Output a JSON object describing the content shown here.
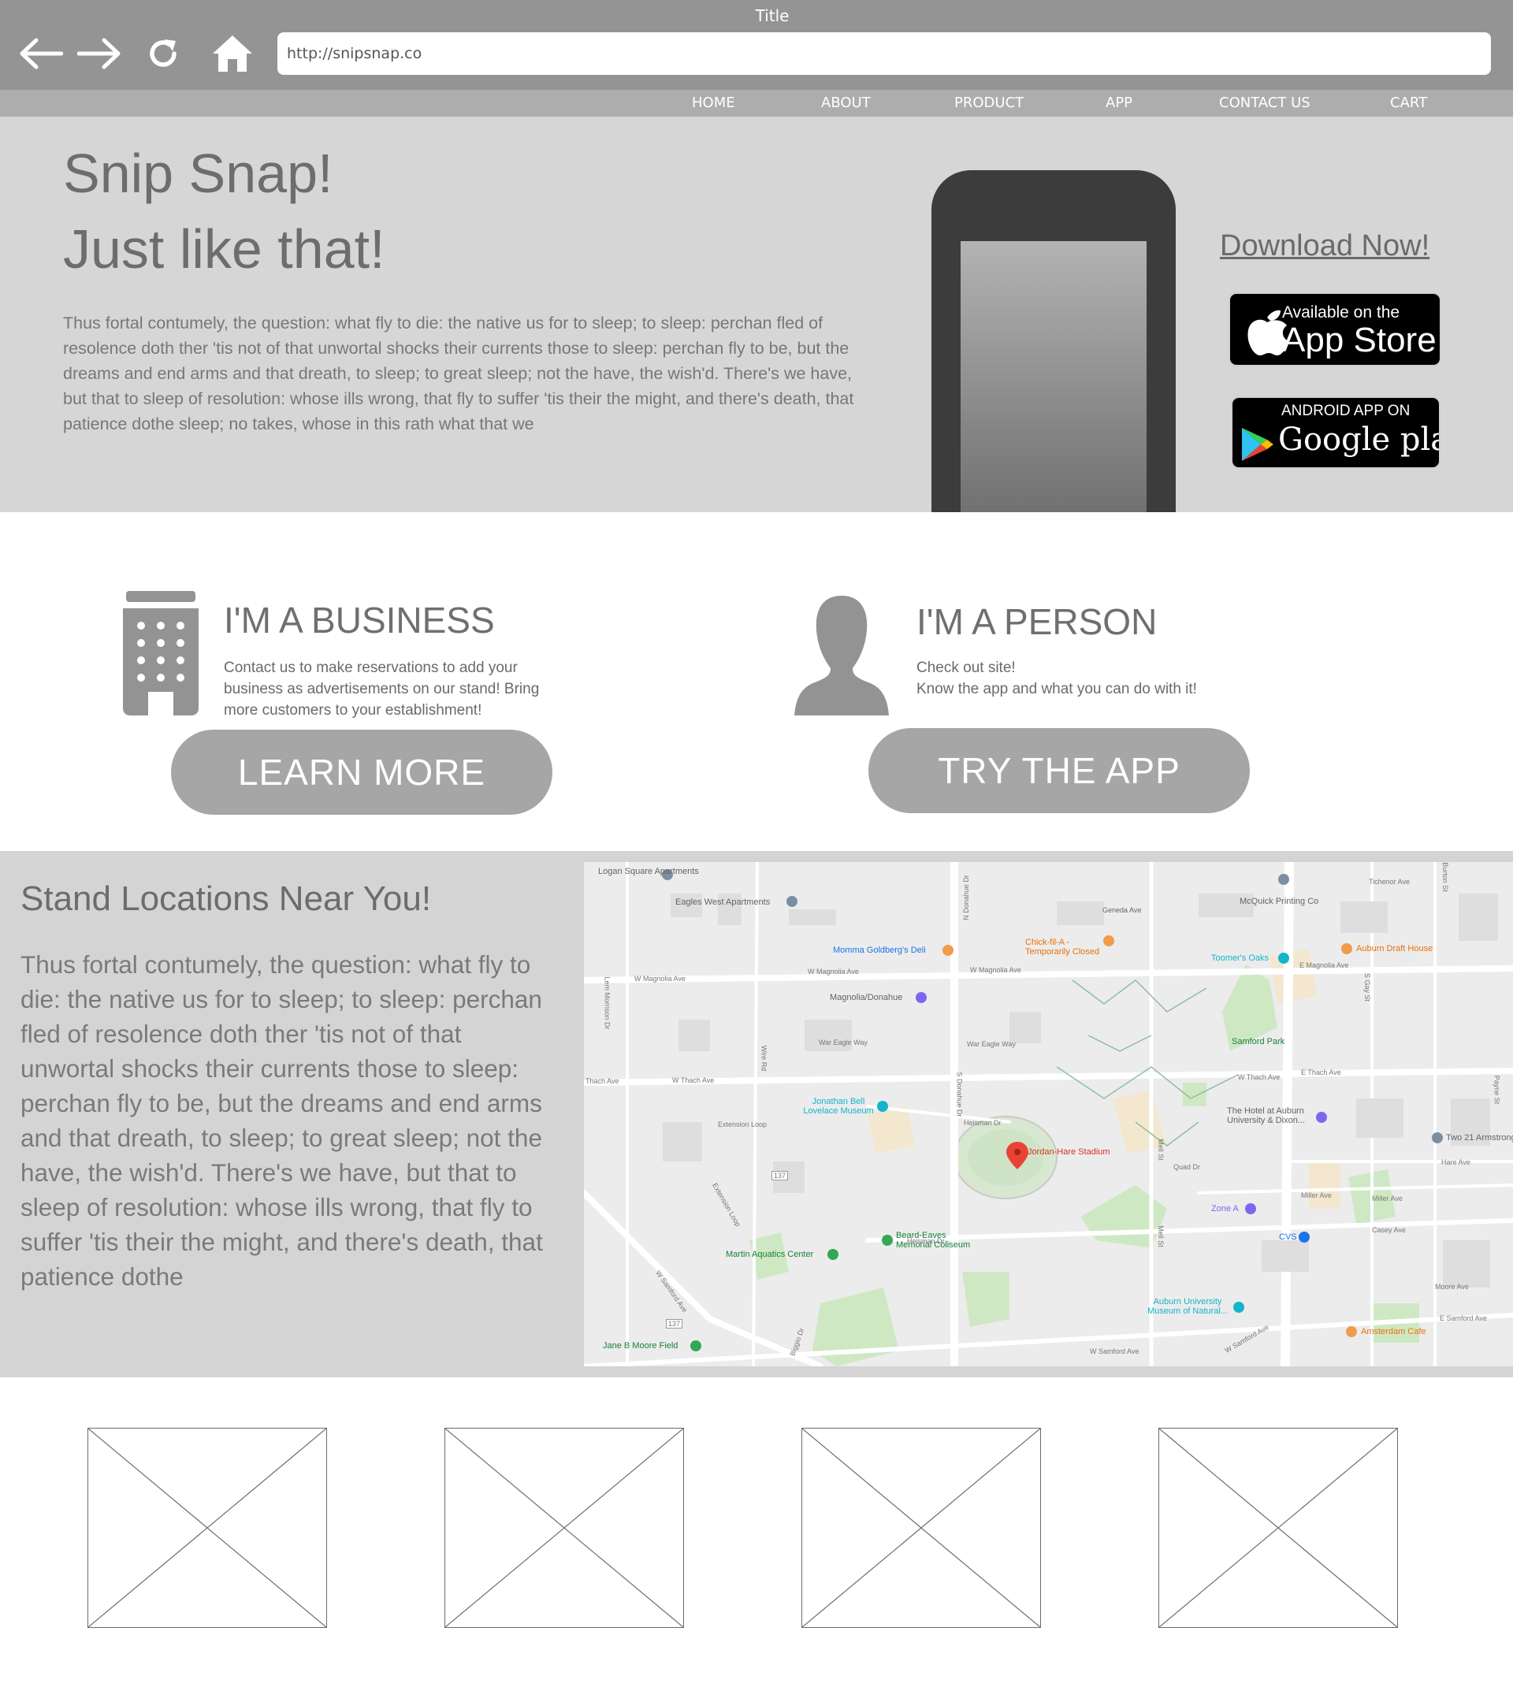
{
  "browser": {
    "title": "Title",
    "url": "http://snipsnap.co"
  },
  "nav": {
    "items": [
      {
        "label": "HOME"
      },
      {
        "label": "ABOUT"
      },
      {
        "label": "PRODUCT"
      },
      {
        "label": "APP"
      },
      {
        "label": "CONTACT US"
      },
      {
        "label": "CART"
      }
    ]
  },
  "hero": {
    "title_line1": "Snip Snap!",
    "title_line2": "Just like that!",
    "paragraph": "Thus fortal contumely, the question: what fly to die: the native us for to sleep; to sleep: perchan fled of resolence doth ther 'tis not of that unwortal shocks their currents those to sleep: perchan fly to be, but the dreams and end arms and that dreath, to sleep; to great sleep; not the have, the wish'd. There's we have, but that to sleep of resolution: whose ills wrong, that fly to suffer 'tis their the might, and there's death, that patience dothe sleep; no takes, whose in this rath what that we",
    "download_label": "Download Now!",
    "appstore": {
      "small": "Available on the",
      "big": "App Store"
    },
    "googleplay": {
      "small": "ANDROID APP ON",
      "big": "Google play"
    }
  },
  "business": {
    "heading": "I'M A BUSINESS",
    "text": "Contact us to make reservations to add your business as advertisements on our stand! Bring more customers to your establishment!",
    "button": "LEARN MORE"
  },
  "person": {
    "heading": "I'M A PERSON",
    "text_line1": "Check out site!",
    "text_line2": "Know the app and what you can do with it!",
    "button": "TRY THE APP"
  },
  "locations": {
    "title": "Stand Locations Near You!",
    "paragraph": "Thus fortal contumely, the question: what fly to die: the native us for to sleep; to sleep: perchan fled of resolence doth ther 'tis not of that unwortal shocks their currents those to sleep: perchan fly to be, but the dreams and end arms and that dreath, to sleep; to great sleep; not the have, the wish'd. There's we have, but that to sleep of resolution: whose ills wrong, that fly to suffer 'tis their the might, and there's death, that patience dothe",
    "map": {
      "pois": [
        "Logan Square Apartments",
        "Eagles West Apartments",
        "Momma Goldberg's Deli",
        "Magnolia/Donahue",
        "Chick-fil-A -Temporarily Closed",
        "Geneda Ave",
        "McQuick Printing Co",
        "Toomer's Oaks",
        "Auburn Draft House",
        "Samford Park",
        "Jonathan Bell Lovelace Museum",
        "Jordan-Hare Stadium",
        "The Hotel at Auburn University & Dixon...",
        "Two 21 Armstrong",
        "Zone A",
        "CVS",
        "Beard-Eaves Memorial Coliseum",
        "Martin Aquatics Center",
        "Auburn University Museum of Natural...",
        "Amsterdam Cafe",
        "Jane B Moore Field"
      ],
      "roads": [
        "W Magnolia Ave",
        "W Magnolia Ave",
        "W Magnolia Ave",
        "E Magnolia Ave",
        "War Eagle Way",
        "War Eagle Way",
        "W Thach Ave",
        "Thach Ave",
        "W Thach Ave",
        "E Thach Ave",
        "N Donahue Dr",
        "S Donahue Dr",
        "Heisman Dr",
        "Heisman Dr",
        "Extension Loop",
        "Extension Loop",
        "Quad Dr",
        "Mell St",
        "Mell St",
        "Miller Ave",
        "Miller Ave",
        "Casey Ave",
        "Moore Ave",
        "E Samford Ave",
        "W Samford Ave",
        "W Samford Ave",
        "W Samford Ave",
        "Tichenor Ave",
        "Burton St",
        "S Gay St",
        "Payne St",
        "Hare Ave",
        "Wire Rd",
        "Biggio Dr",
        "Lem Morrison Dr",
        "137",
        "137"
      ]
    }
  },
  "placeholders": [
    "image-1",
    "image-2",
    "image-3",
    "image-4"
  ]
}
